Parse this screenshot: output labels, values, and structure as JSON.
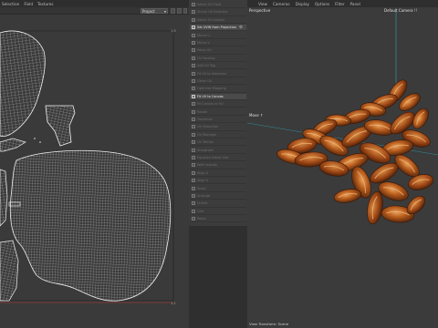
{
  "uv_editor": {
    "menu": [
      "Selection",
      "Field",
      "Textures"
    ],
    "project_select": "Project",
    "corner_top_right": "1,0",
    "corner_bottom_right": "1,1"
  },
  "uv_commands": [
    {
      "label": "Select UV Field",
      "active": false
    },
    {
      "label": "Shrink UV Selection",
      "active": false
    },
    {
      "label": "Select UV Islands",
      "active": false
    },
    {
      "label": "Set UVW from Projection",
      "active": true,
      "gear": true
    },
    {
      "label": "Mirror U",
      "active": false
    },
    {
      "label": "Mirror V",
      "active": false
    },
    {
      "label": "Relax UV",
      "active": false
    },
    {
      "label": "UV Packing",
      "active": false
    },
    {
      "label": "Add UV Tag",
      "active": false
    },
    {
      "label": "Fit UV to Selection",
      "active": false
    },
    {
      "label": "Clean UV",
      "active": false
    },
    {
      "label": "Optimize Mapping",
      "active": false
    },
    {
      "label": "Fit UV to Canvas",
      "active": true
    },
    {
      "label": "Fit Canvas to UV",
      "active": false
    },
    {
      "label": "Rotate",
      "active": false
    },
    {
      "label": "Transform",
      "active": false
    },
    {
      "label": "UV Distortion",
      "active": false
    },
    {
      "label": "UV Manager",
      "active": false
    },
    {
      "label": "UV Terrain",
      "active": false
    },
    {
      "label": "Straighten",
      "active": false
    },
    {
      "label": "Equalize Island Size",
      "active": false
    },
    {
      "label": "Weld Islands",
      "active": false
    },
    {
      "label": "Align U",
      "active": false
    },
    {
      "label": "Align V",
      "active": false
    },
    {
      "label": "Stack",
      "active": false
    },
    {
      "label": "Arrange",
      "active": false
    },
    {
      "label": "Unfold",
      "active": false
    },
    {
      "label": "Grid",
      "active": false
    },
    {
      "label": "Relax",
      "active": false
    }
  ],
  "viewport": {
    "menu": [
      "View",
      "Cameras",
      "Display",
      "Options",
      "Filter",
      "Panel"
    ],
    "view_title": "Perspective",
    "camera_title": "Default Camera !!",
    "move_label": "Move ↑",
    "status_text": "View Transform: Scene"
  },
  "colors": {
    "uv_background": "#3a3a3a",
    "uv_wire": "#e4e4e4",
    "viewport_background": "#3b3b3b",
    "axis_teal": "#2aa6b3",
    "active_button": "#4a4a4a",
    "pecan_dark": "#5a2a0d",
    "pecan_mid": "#a4511a",
    "pecan_light": "#d98a3e"
  }
}
